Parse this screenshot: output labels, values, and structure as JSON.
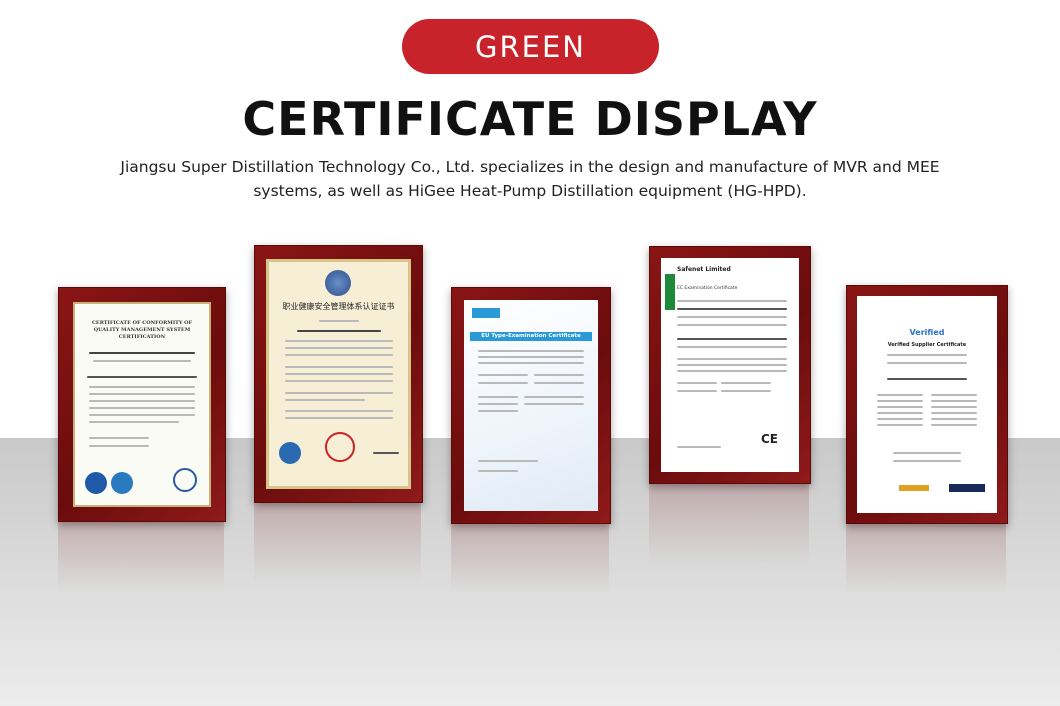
{
  "header": {
    "brand": "GREEN",
    "title": "CERTIFICATE DISPLAY",
    "description_line1": "Jiangsu Super Distillation Technology Co., Ltd. specializes in the design and manufacture of MVR and MEE",
    "description_line2": "systems, as well as HiGee Heat-Pump Distillation equipment (HG-HPD)."
  },
  "certificates": [
    {
      "name": "CERTIFICATE OF CONFORMITY OF QUALITY MANAGEMENT SYSTEM CERTIFICATION",
      "icons": [
        "IAF",
        "CNAS"
      ]
    },
    {
      "name": "职业健康安全管理体系认证证书",
      "icons": [
        "CNAS"
      ]
    },
    {
      "name": "EU Type-Examination Certificate",
      "icons": [
        "SATRA"
      ]
    },
    {
      "name": "Safenet Limited",
      "subname": "EC Examination Certificate",
      "icons": [
        "CE"
      ]
    },
    {
      "name": "Verified",
      "subname": "Verified Supplier Certificate",
      "icons": [
        "intertek"
      ]
    }
  ],
  "colors": {
    "brand_red": "#c8222a",
    "frame": "#7a1010",
    "floor": "#d3d3d3"
  }
}
